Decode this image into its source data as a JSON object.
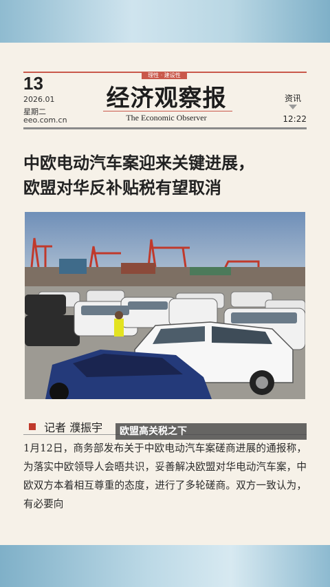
{
  "masthead": {
    "issue_number": "13",
    "date": "2026.01",
    "weekday": "星期二",
    "website": "eeo.com.cn",
    "slogan": "理性 · 建设性",
    "title_cn": "经济观察报",
    "title_en": "The Economic Observer",
    "section": "资讯",
    "time": "12:22"
  },
  "article": {
    "headline_line1": "中欧电动汽车案迎来关键进展，",
    "headline_line2": "欧盟对华反补贴税有望取消",
    "photo_caption": "欧盟高关税之下",
    "author": "记者  濮振宇",
    "body": "1月12日，商务部发布关于中欧电动汽车案磋商进展的通报称，为落实中欧领导人会晤共识，妥善解决欧盟对华电动汽车案，中欧双方本着相互尊重的态度，进行了多轮磋商。双方一致认为，有必要向"
  },
  "colors": {
    "accent": "#c9584a",
    "paper": "#f6f1e8",
    "frame": "#9ec3d6"
  }
}
